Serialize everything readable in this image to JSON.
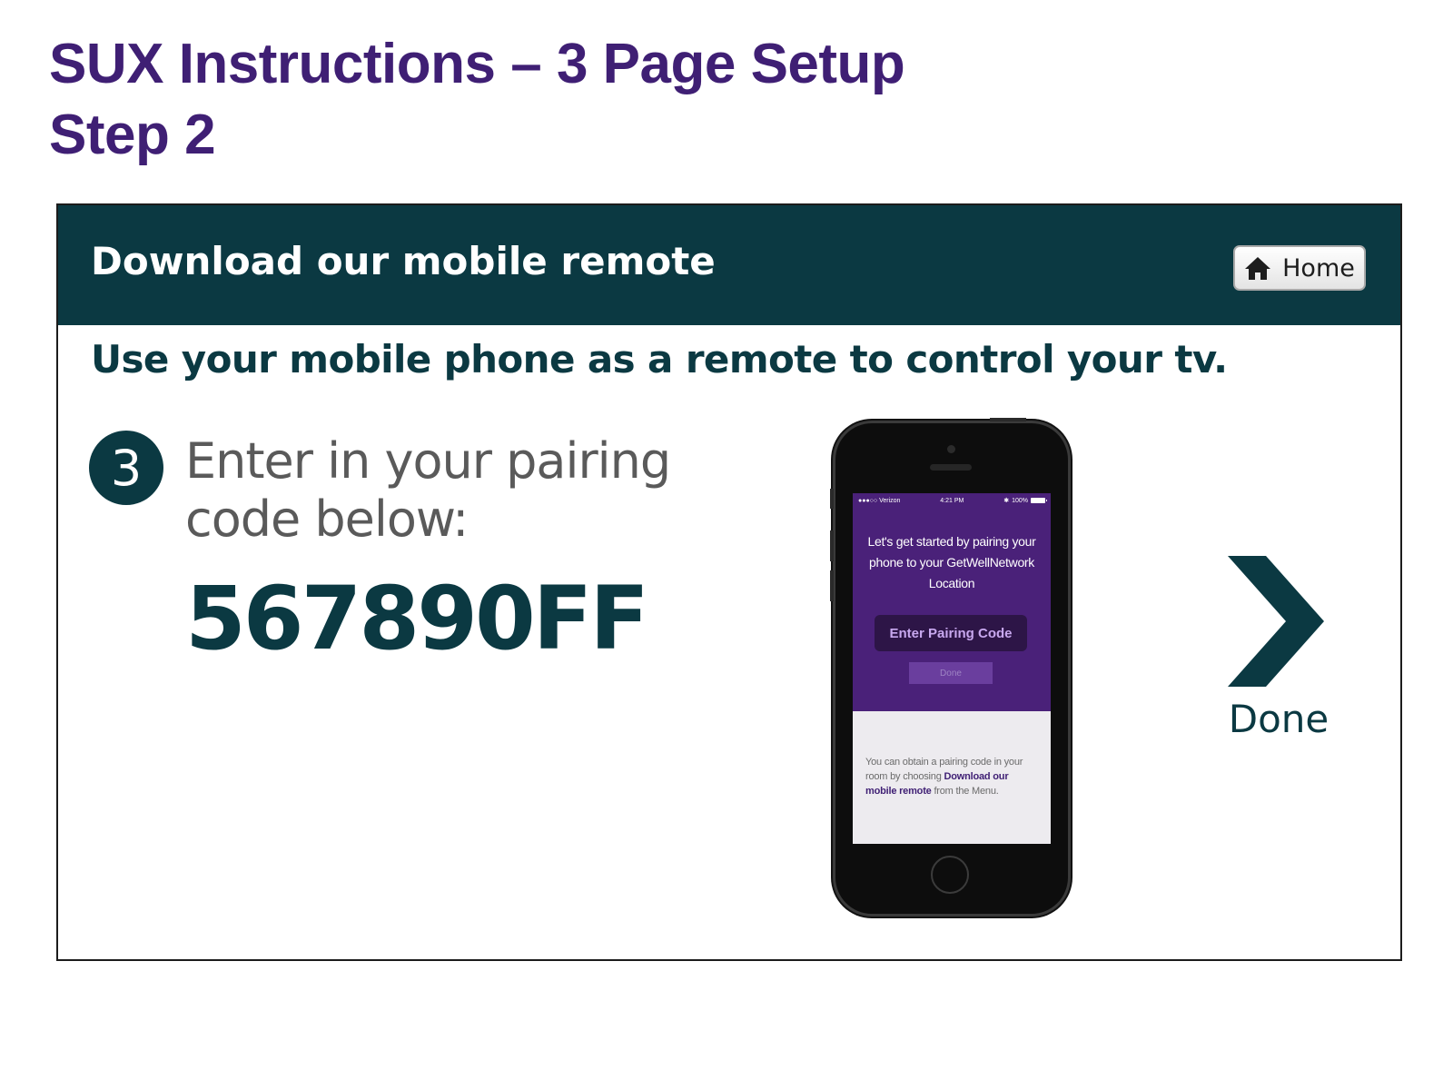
{
  "slide": {
    "title_line1": "SUX Instructions – 3 Page Setup",
    "title_line2": "Step 2"
  },
  "tv": {
    "header_title": "Download our mobile remote",
    "home_label": "Home",
    "home_icon": "home-icon",
    "subtitle": "Use your mobile phone as a remote to control your tv.",
    "step_number": "3",
    "step_text": "Enter in your pairing code below:",
    "pairing_code": "567890FF",
    "done_label": "Done",
    "done_icon": "chevron-right-icon"
  },
  "phone": {
    "status_carrier": "●●●○○ Verizon",
    "status_time": "4:21 PM",
    "status_bluetooth": "✱",
    "status_battery": "100%",
    "intro_text": "Let's get started by pairing your phone to your GetWellNetwork Location",
    "pairing_placeholder": "Enter Pairing Code",
    "done_button": "Done",
    "help_prefix": "You can obtain a pairing code in your room by choosing ",
    "help_bold": "Download our mobile remote",
    "help_suffix": " from the Menu."
  },
  "colors": {
    "slide_title": "#3f1f74",
    "tv_header_bg": "#0b3942",
    "phone_purple": "#4a2179",
    "pairing_text": "#c8a8ef"
  }
}
